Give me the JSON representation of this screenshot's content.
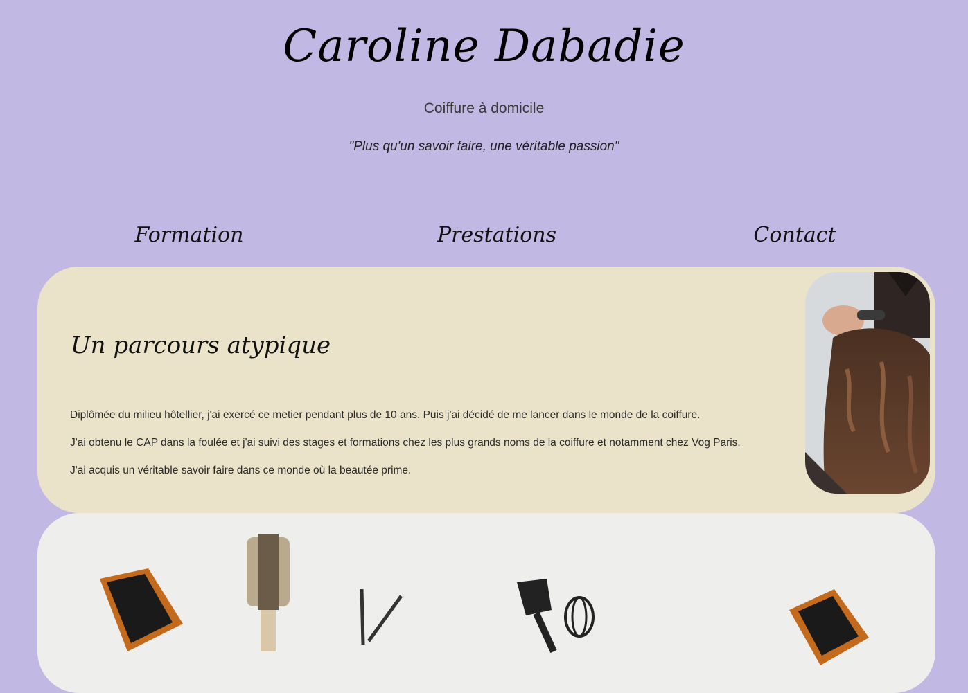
{
  "header": {
    "title": "Caroline Dabadie",
    "subtitle": "Coiffure à domicile",
    "tagline": "\"Plus qu'un savoir faire, une véritable passion\""
  },
  "nav": {
    "items": [
      "Formation",
      "Prestations",
      "Contact"
    ]
  },
  "about": {
    "heading": "Un parcours atypique",
    "paragraphs": [
      "Diplômée du milieu hôtellier, j'ai exercé ce metier pendant plus de 10 ans. Puis j'ai décidé de me lancer dans le monde de la coiffure.",
      "J'ai obtenu le CAP dans la foulée et j'ai suivi des stages et formations chez les plus grands noms de la coiffure et notamment chez Vog Paris.",
      "J'ai acquis un véritable savoir faire dans ce monde où la beautée prime."
    ]
  },
  "colors": {
    "background": "#c1b8e3",
    "card": "#ebe3c9",
    "tools_card": "#eeeeec"
  }
}
